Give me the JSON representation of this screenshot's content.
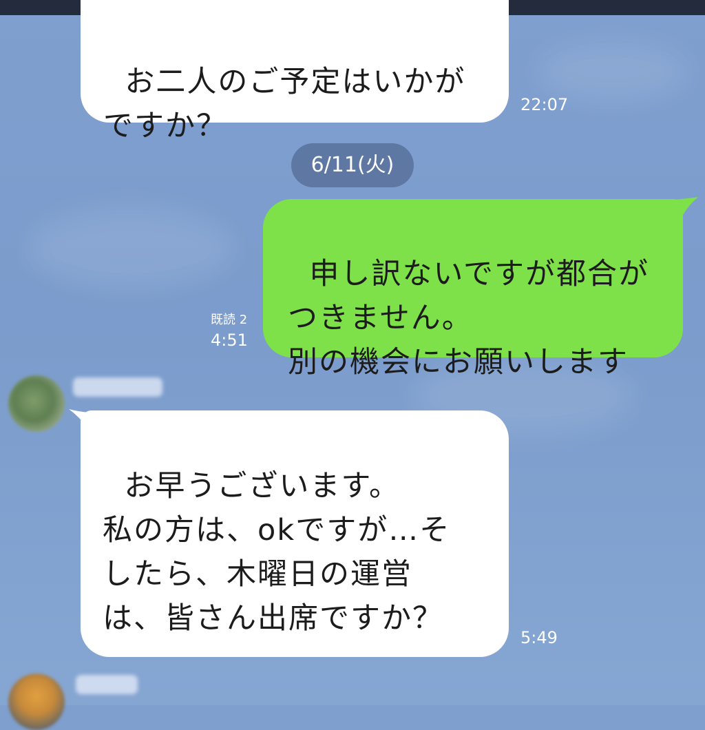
{
  "messages": {
    "m1": {
      "text": "お二人のご予定はいかが\nですか？",
      "time": "22:07"
    },
    "date_separator": "6/11(火)",
    "m2": {
      "text": "申し訳ないですが都合が\nつきません。\n別の機会にお願いします",
      "read_label": "既読 2",
      "time": "4:51"
    },
    "m3": {
      "text": "お早うございます。\n私の方は、okですが…そ\nしたら、木曜日の運営\nは、皆さん出席ですか？",
      "time": "5:49"
    }
  },
  "colors": {
    "background": "#7f9fcf",
    "incoming_bubble": "#ffffff",
    "outgoing_bubble": "#7ee14a",
    "topbar": "#232b3d"
  }
}
